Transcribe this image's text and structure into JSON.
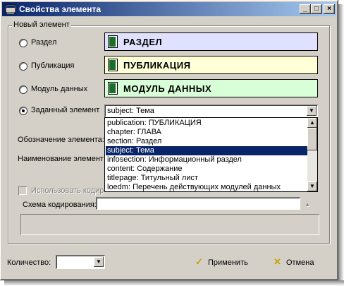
{
  "window": {
    "title": "Свойства элемента"
  },
  "titlebar_buttons": {
    "minimize": "_",
    "maximize": "□",
    "close": "×"
  },
  "group": {
    "label": "Новый элемент"
  },
  "options": [
    {
      "label": "Раздел",
      "box_text": "РАЗДЕЛ",
      "box_color": "#e0e0ff",
      "checked": false
    },
    {
      "label": "Публикация",
      "box_text": "ПУБЛИКАЦИЯ",
      "box_color": "#ffffd8",
      "checked": false
    },
    {
      "label": "Модуль данных",
      "box_text": "МОДУЛЬ ДАННЫХ",
      "box_color": "#d8ffd8",
      "checked": false
    },
    {
      "label": "Заданный элемент",
      "checked": true
    }
  ],
  "combo": {
    "value": "subject:  Тема"
  },
  "dropdown_items": [
    "publication:  ПУБЛИКАЦИЯ",
    "chapter:  ГЛАВА",
    "section:  Раздел",
    "subject:  Тема",
    "infosection:  Информационный раздел",
    "content:  Содержание",
    "titlepage:  Титульный лист",
    "loedm:  Перечень действующих модулей данных"
  ],
  "selected_index": 3,
  "fields": {
    "designation_label": "Обозначение элемента:",
    "name_label": "Наименование элемент",
    "use_coding_label": "Использовать кодир",
    "scheme_label": "Схема кодирования:",
    "scheme_value": ""
  },
  "bottom": {
    "quantity_label": "Количество:",
    "quantity_value": "",
    "apply_label": "Применить",
    "cancel_label": "Отмена",
    "apply_icon": "✓",
    "cancel_icon": "✕"
  }
}
